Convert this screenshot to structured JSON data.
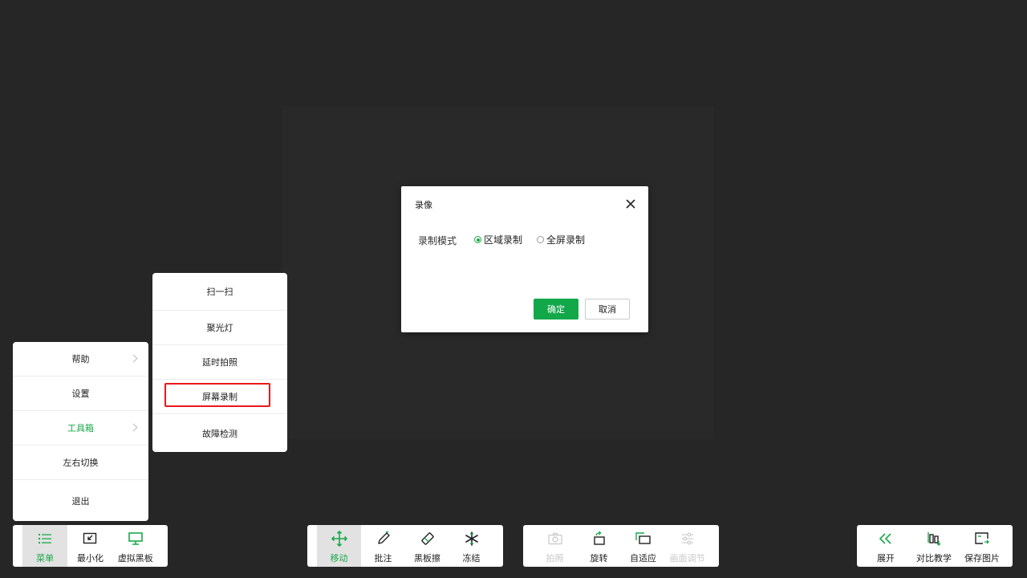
{
  "colors": {
    "accent": "#1aa84a",
    "background": "#262626",
    "highlight": "#e8191c"
  },
  "dialog": {
    "title": "录像",
    "mode_label": "录制模式",
    "options": [
      {
        "label": "区域录制",
        "selected": true
      },
      {
        "label": "全屏录制",
        "selected": false
      }
    ],
    "ok_label": "确定",
    "cancel_label": "取消"
  },
  "main_menu": {
    "items": [
      {
        "label": "帮助",
        "has_submenu": true
      },
      {
        "label": "设置"
      },
      {
        "label": "工具箱",
        "has_submenu": true,
        "active": true
      },
      {
        "label": "左右切换"
      },
      {
        "label": "退出"
      }
    ]
  },
  "sub_menu": {
    "items": [
      {
        "label": "扫一扫"
      },
      {
        "label": "聚光灯"
      },
      {
        "label": "延时拍照"
      },
      {
        "label": "屏幕录制",
        "highlighted": true
      },
      {
        "label": "故障检测"
      }
    ]
  },
  "toolbar_left": [
    {
      "label": "菜单",
      "icon": "list-icon",
      "active": true
    },
    {
      "label": "最小化",
      "icon": "minimize-icon"
    },
    {
      "label": "虚拟黑板",
      "icon": "monitor-icon"
    }
  ],
  "toolbar_mid": [
    {
      "label": "移动",
      "icon": "move-icon",
      "active": true
    },
    {
      "label": "批注",
      "icon": "pen-icon"
    },
    {
      "label": "黑板擦",
      "icon": "eraser-icon"
    },
    {
      "label": "冻结",
      "icon": "snowflake-icon"
    }
  ],
  "toolbar_view": [
    {
      "label": "拍照",
      "icon": "camera-icon",
      "disabled": true
    },
    {
      "label": "旋转",
      "icon": "rotate-icon"
    },
    {
      "label": "自适应",
      "icon": "fit-icon"
    },
    {
      "label": "画面调节",
      "icon": "sliders-icon",
      "disabled": true
    }
  ],
  "toolbar_right": [
    {
      "label": "展开",
      "icon": "double-chevron-left-icon"
    },
    {
      "label": "对比教学",
      "icon": "compare-icon"
    },
    {
      "label": "保存图片",
      "icon": "save-image-icon"
    }
  ]
}
